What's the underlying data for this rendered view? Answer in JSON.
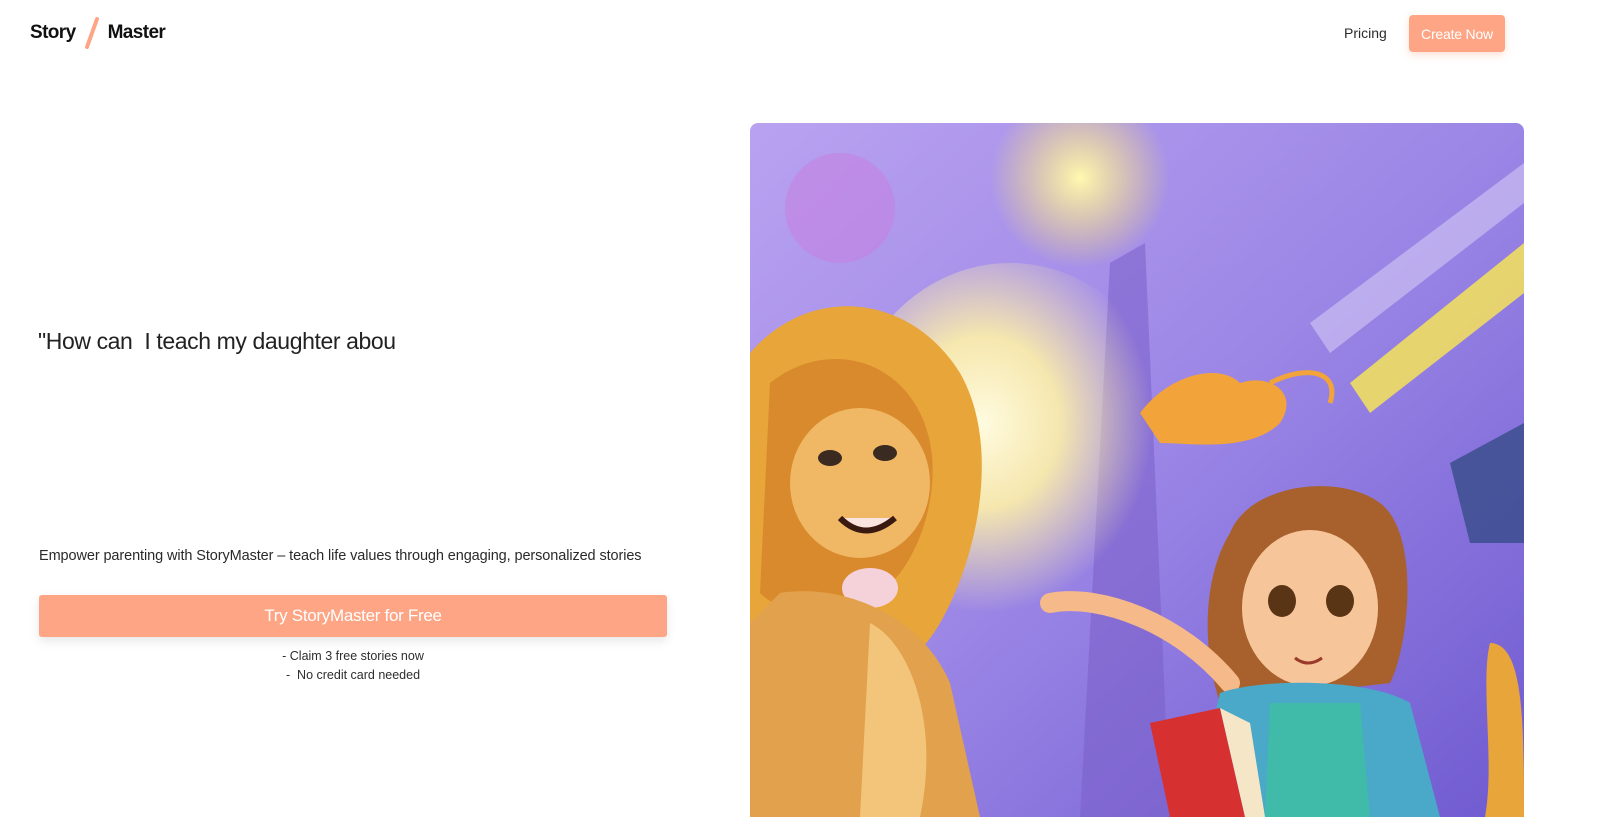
{
  "header": {
    "logo": {
      "word1": "Story",
      "word2": "Master"
    },
    "nav": {
      "pricing_label": "Pricing"
    },
    "create_button_label": "Create Now"
  },
  "hero": {
    "headline": "\"How can  I teach my daughter abou",
    "subtitle": "Empower parenting with StoryMaster – teach life values through engaging, personalized stories",
    "cta_label": "Try StoryMaster for  Free",
    "notes": [
      "- Claim 3 free stories now",
      "-  No credit card needed"
    ],
    "image": {
      "icon": "illustration-lion-and-girl-reading",
      "description_visible": false
    }
  },
  "colors": {
    "accent": "#fda585",
    "text": "#222222",
    "background": "#ffffff"
  }
}
